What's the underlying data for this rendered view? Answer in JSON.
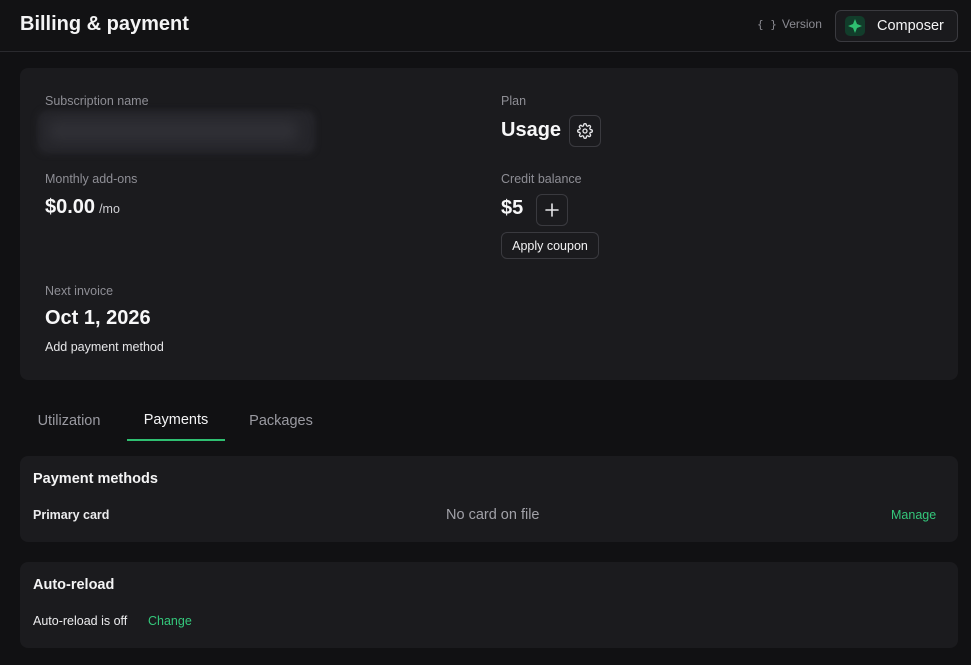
{
  "header": {
    "title": "Billing & payment",
    "version_braces": "{ }",
    "version_label": "Version",
    "composer_label": "Composer"
  },
  "summary": {
    "subscription_label": "Subscription name",
    "monthly_addons_label": "Monthly add-ons",
    "monthly_addons_value": "$0.00",
    "monthly_addons_unit": "/mo",
    "next_invoice_label": "Next invoice",
    "next_invoice_value": "Oct 1, 2026",
    "add_payment_label": "Add payment method",
    "plan_label": "Plan",
    "plan_value": "Usage",
    "credit_label": "Credit balance",
    "credit_value": "$5",
    "apply_coupon_label": "Apply coupon"
  },
  "tabs": [
    {
      "label": "Utilization"
    },
    {
      "label": "Payments",
      "active": true
    },
    {
      "label": "Packages"
    }
  ],
  "payment_methods": {
    "title": "Payment methods",
    "primary_label": "Primary card",
    "card_status": "No card on file",
    "manage_label": "Manage"
  },
  "auto_reload": {
    "title": "Auto-reload",
    "status": "Auto-reload is off",
    "change_label": "Change"
  },
  "colors": {
    "accent": "#2fbf71",
    "background": "#111113",
    "card": "#1b1b1e"
  },
  "icons": [
    "composer-logo-icon",
    "gear-icon",
    "plus-icon"
  ]
}
